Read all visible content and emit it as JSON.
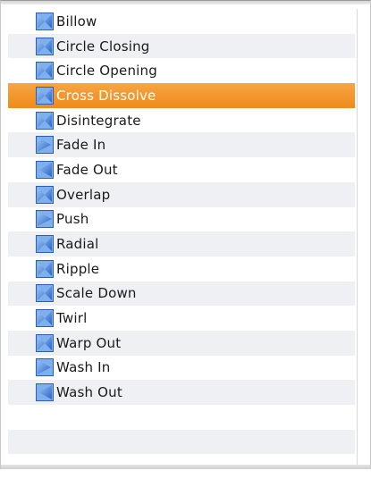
{
  "selected_index": 3,
  "colors": {
    "selection": "#f39a2c",
    "stripe": "#eef0f3",
    "icon_blue": "#3c78d8"
  },
  "transitions": [
    {
      "label": "Billow",
      "icon": "transition-icon"
    },
    {
      "label": "Circle Closing",
      "icon": "transition-icon"
    },
    {
      "label": "Circle Opening",
      "icon": "transition-icon"
    },
    {
      "label": "Cross Dissolve",
      "icon": "transition-icon"
    },
    {
      "label": "Disintegrate",
      "icon": "transition-icon"
    },
    {
      "label": "Fade In",
      "icon": "fade-in-icon"
    },
    {
      "label": "Fade Out",
      "icon": "fade-out-icon"
    },
    {
      "label": "Overlap",
      "icon": "transition-icon"
    },
    {
      "label": "Push",
      "icon": "push-icon"
    },
    {
      "label": "Radial",
      "icon": "transition-icon"
    },
    {
      "label": "Ripple",
      "icon": "transition-icon"
    },
    {
      "label": "Scale Down",
      "icon": "transition-icon"
    },
    {
      "label": "Twirl",
      "icon": "transition-icon"
    },
    {
      "label": "Warp Out",
      "icon": "transition-icon"
    },
    {
      "label": "Wash In",
      "icon": "wash-in-icon"
    },
    {
      "label": "Wash Out",
      "icon": "wash-out-icon"
    }
  ]
}
